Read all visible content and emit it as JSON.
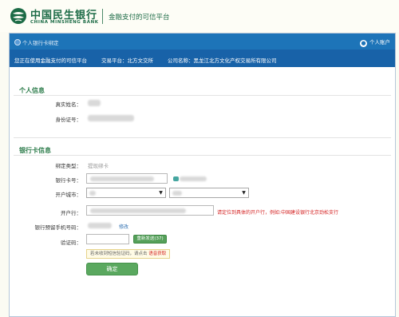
{
  "brand": {
    "name_cn": "中国民生银行",
    "name_en": "CHINA MINSHENG BANK",
    "tagline": "金融支付的可信平台"
  },
  "titlebar": {
    "left_label": "个人银行卡绑定",
    "right_label": "个人账户"
  },
  "infobar": {
    "using_label": "您正在使用金融支付的可信平台",
    "platform_label": "交易平台：北方文交所",
    "company_label": "公司名称：黑龙江北方文化产权交易所有限公司"
  },
  "personal": {
    "section_title": "个人信息",
    "name_label": "真实姓名：",
    "id_label": "身份证号："
  },
  "bankcard": {
    "section_title": "银行卡信息",
    "bind_type_label": "绑定类型：",
    "bind_type_value": "提现绑卡",
    "card_no_label": "银行卡号：",
    "city_label": "开户城市：",
    "branch_label": "开户行：",
    "branch_hint": "请定位到具体的开户行，例如:中国建设银行北京劲松支行",
    "phone_label": "银行预留手机号码：",
    "phone_modify_link": "修改",
    "code_label": "验证码：",
    "resend_button": "重新发送(37)",
    "notice_text": "若未收到短信验证码，请点击",
    "notice_voice_link": "语音获取",
    "confirm_button": "确定"
  },
  "colors": {
    "brand_green": "#1c6b46",
    "titlebar_blue": "#1d74b8",
    "infobar_blue": "#1862a8",
    "section_green": "#2e7d4c",
    "button_green": "#5aa85f",
    "hint_red": "#d42121"
  },
  "icons": {
    "logo": "minsheng-logo-icon",
    "title_dot": "dot-icon",
    "account": "user-icon",
    "select_arrow": "chevron-down-icon"
  }
}
